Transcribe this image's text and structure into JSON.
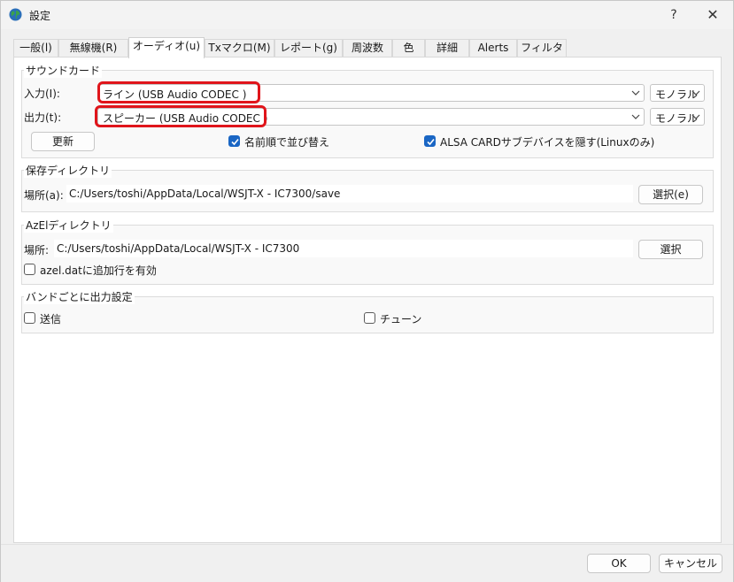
{
  "window": {
    "title": "設定",
    "help_glyph": "?",
    "close_glyph": "✕"
  },
  "tabs": [
    {
      "label": "一般(l)"
    },
    {
      "label": "無線機(R)"
    },
    {
      "label": "オーディオ(u)",
      "active": true
    },
    {
      "label": "Txマクロ(M)"
    },
    {
      "label": "レポート(g)"
    },
    {
      "label": "周波数"
    },
    {
      "label": "色"
    },
    {
      "label": "詳細"
    },
    {
      "label": "Alerts"
    },
    {
      "label": "フィルタ"
    }
  ],
  "soundcard": {
    "title": "サウンドカード",
    "input_label": "入力(I):",
    "input_value": "ライン (USB Audio CODEC )",
    "input_channel": "モノラル",
    "output_label": "出力(t):",
    "output_value": "スピーカー (USB Audio CODEC )",
    "output_channel": "モノラル",
    "refresh_label": "更新",
    "sort_label": "名前順で並び替え",
    "sort_checked": true,
    "alsa_label": "ALSA CARDサブデバイスを隠す(Linuxのみ)",
    "alsa_checked": true
  },
  "save_dir": {
    "title": "保存ディレクトリ",
    "location_label": "場所(a):",
    "path": "C:/Users/toshi/AppData/Local/WSJT-X - IC7300/save",
    "select_label": "選択(e)"
  },
  "azel_dir": {
    "title": "AzElディレクトリ",
    "location_label": "場所:",
    "path": "C:/Users/toshi/AppData/Local/WSJT-X - IC7300",
    "select_label": "選択",
    "append_label": "azel.datに追加行を有効",
    "append_checked": false
  },
  "band_output": {
    "title": "バンドごとに出力設定",
    "transmit_label": "送信",
    "transmit_checked": false,
    "tune_label": "チューン",
    "tune_checked": false
  },
  "buttons": {
    "ok_label": "OK",
    "cancel_label": "キャンセル"
  },
  "colors": {
    "highlight": "#e0151b",
    "checkbox_accent": "#1a66c4"
  }
}
